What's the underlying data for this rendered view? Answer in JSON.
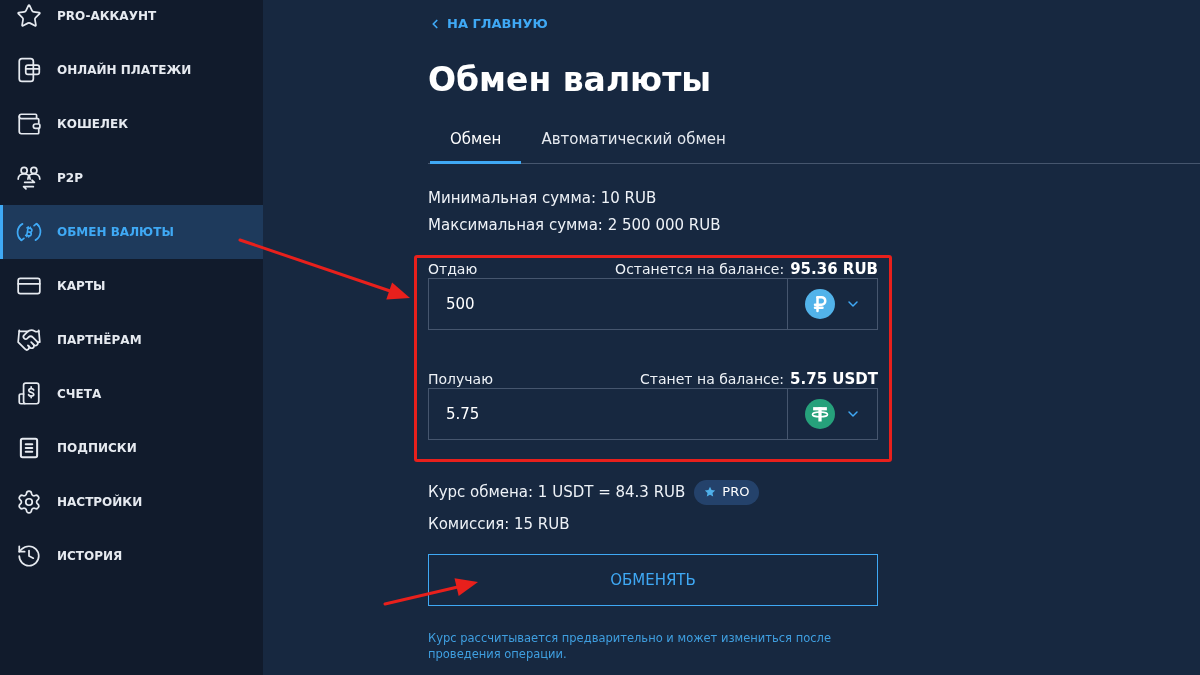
{
  "sidebar": {
    "items": [
      {
        "label": "PRO-АККАУНТ",
        "selected": false
      },
      {
        "label": "ОНЛАЙН ПЛАТЕЖИ",
        "selected": false
      },
      {
        "label": "КОШЕЛЕК",
        "selected": false
      },
      {
        "label": "P2P",
        "selected": false
      },
      {
        "label": "ОБМЕН ВАЛЮТЫ",
        "selected": true
      },
      {
        "label": "КАРТЫ",
        "selected": false
      },
      {
        "label": "ПАРТНЁРАМ",
        "selected": false
      },
      {
        "label": "СЧЕТА",
        "selected": false
      },
      {
        "label": "ПОДПИСКИ",
        "selected": false
      },
      {
        "label": "НАСТРОЙКИ",
        "selected": false
      },
      {
        "label": "ИСТОРИЯ",
        "selected": false
      }
    ]
  },
  "back_link": "НА ГЛАВНУЮ",
  "title": "Обмен валюты",
  "tabs": [
    {
      "label": "Обмен",
      "selected": true
    },
    {
      "label": "Автоматический обмен",
      "selected": false
    }
  ],
  "limits": [
    "Минимальная сумма: 10 RUB",
    "Максимальная сумма: 2 500 000 RUB"
  ],
  "exchange_form": {
    "highlighted": true,
    "fields": [
      {
        "label": "Отдаю",
        "balance_label": "Останется на балансе:",
        "balance_value": "95.36 RUB",
        "value": "500",
        "kind": "rub"
      },
      {
        "label": "Получаю",
        "balance_label": "Станет на балансе:",
        "balance_value": "5.75 USDT",
        "value": "5.75",
        "kind": "usdt"
      }
    ]
  },
  "rate": {
    "text": "Курс обмена: 1 USDT = 84.3 RUB",
    "badge": "PRO"
  },
  "commission": "Комиссия: 15 RUB",
  "submit_button": "ОБМЕНЯТЬ",
  "note": "Курс рассчитывается предварительно и может измениться после проведения операции.",
  "annotations": [
    {
      "kind": "arrow"
    },
    {
      "kind": "arrow"
    }
  ]
}
